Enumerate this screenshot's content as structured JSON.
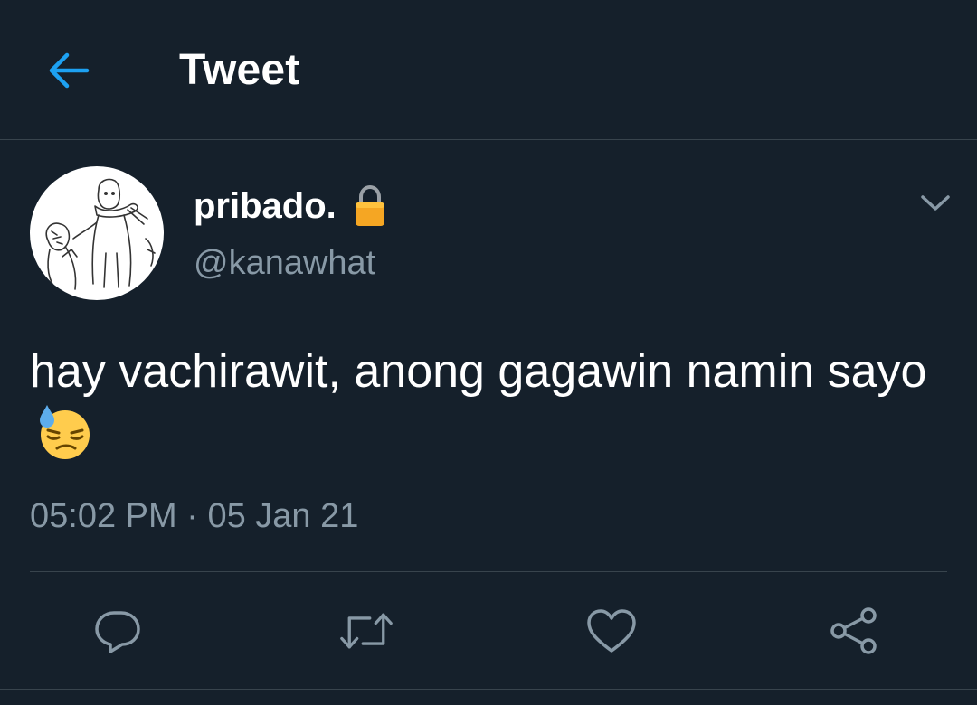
{
  "colors": {
    "background": "#15202b",
    "accent": "#1da1f2",
    "secondary_text": "#8899a6",
    "divider": "#38444d"
  },
  "header": {
    "back_icon": "arrow-left-icon",
    "title": "Tweet"
  },
  "tweet": {
    "author": {
      "display_name": "pribado.",
      "lock_icon": "lock-icon",
      "handle": "@kanawhat"
    },
    "menu_icon": "chevron-down-icon",
    "text": "hay vachirawit, anong gagawin namin sayo",
    "emoji": "downcast-face-with-sweat-emoji",
    "time": "05:02 PM",
    "separator": "·",
    "date": "05 Jan 21"
  },
  "actions": [
    {
      "name": "reply",
      "icon": "reply-icon"
    },
    {
      "name": "retweet",
      "icon": "retweet-icon"
    },
    {
      "name": "like",
      "icon": "heart-icon"
    },
    {
      "name": "share",
      "icon": "share-icon"
    }
  ]
}
